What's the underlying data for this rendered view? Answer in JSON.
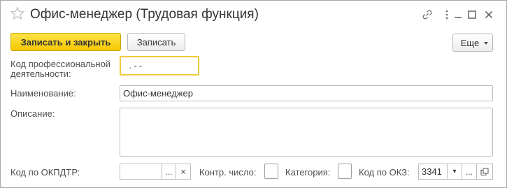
{
  "window": {
    "title": "Офис-менеджер (Трудовая функция)",
    "icons": [
      "star-icon",
      "link-icon",
      "more-vert-icon",
      "minimize-icon",
      "maximize-icon",
      "close-icon"
    ]
  },
  "toolbar": {
    "save_close_label": "Записать и закрыть",
    "save_label": "Записать",
    "more_label": "Еще"
  },
  "form": {
    "prof_code_label_line1": "Код профессиональной",
    "prof_code_label_line2": "деятельности:",
    "prof_code_value": ". - -",
    "name_label": "Наименование:",
    "name_value": "Офис-менеджер",
    "description_label": "Описание:",
    "description_value": "",
    "okpdtr_label": "Код по ОКПДТР:",
    "okpdtr_value": "",
    "okpdtr_select": "...",
    "okpdtr_clear": "×",
    "control_number_label": "Контр. число:",
    "category_label": "Категория:",
    "okz_label": "Код по ОКЗ:",
    "okz_value": "3341",
    "okz_select": "...",
    "okz_dropdown": "▾"
  },
  "colors": {
    "primary_button": "#f5c800",
    "focus_border": "#f0c93a",
    "star": "#c6c6c6"
  }
}
